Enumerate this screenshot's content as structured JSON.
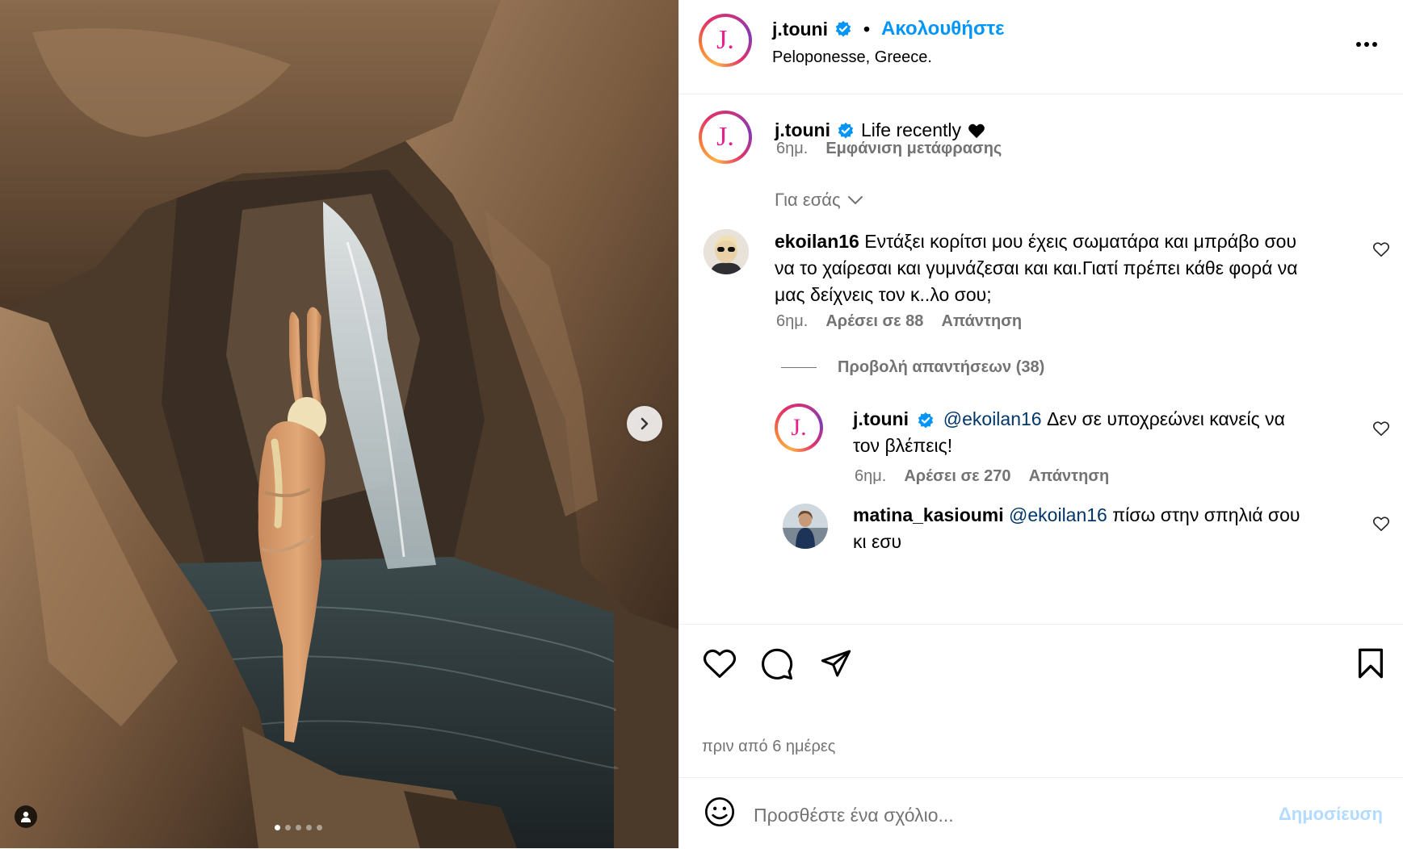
{
  "post": {
    "carousel_dots": 5,
    "active_dot": 0
  },
  "header": {
    "username": "j.touni",
    "separator": "•",
    "follow_label": "Ακολουθήστε",
    "location": "Peloponesse, Greece.",
    "avatar_letter": "J."
  },
  "caption": {
    "username": "j.touni",
    "text": "Life recently",
    "time": "6ημ.",
    "translate_label": "Εμφάνιση μετάφρασης"
  },
  "sort": {
    "label": "Για εσάς"
  },
  "comments": [
    {
      "username": "ekoilan16",
      "text": "Εντάξει κορίτσι μου έχεις σωματάρα και μπράβο σου να το χαίρεσαι και γυμνάζεσαι και και.Γιατί πρέπει κάθε φορά να μας δείχνεις τον κ..λο σου;",
      "time": "6ημ.",
      "likes": "Αρέσει σε 88",
      "reply": "Απάντηση",
      "view_replies": "Προβολή απαντήσεων (38)"
    }
  ],
  "replies": [
    {
      "username": "j.touni",
      "mention": "@ekoilan16",
      "text": "Δεν σε υποχρεώνει κανείς να τον βλέπεις!",
      "time": "6ημ.",
      "likes": "Αρέσει σε 270",
      "reply": "Απάντηση"
    },
    {
      "username": "matina_kasioumi",
      "mention": "@ekoilan16",
      "text": "πίσω στην σπηλιά σου κι εσυ"
    }
  ],
  "footer": {
    "time_ago": "πριν από 6 ημέρες",
    "comment_placeholder": "Προσθέστε ένα σχόλιο...",
    "post_label": "Δημοσίευση"
  },
  "colors": {
    "accent": "#0095f6",
    "verified": "#0095f6",
    "mention": "#00376b",
    "avatar_letter": "#e4208a",
    "post_disabled": "#b3dbff"
  }
}
